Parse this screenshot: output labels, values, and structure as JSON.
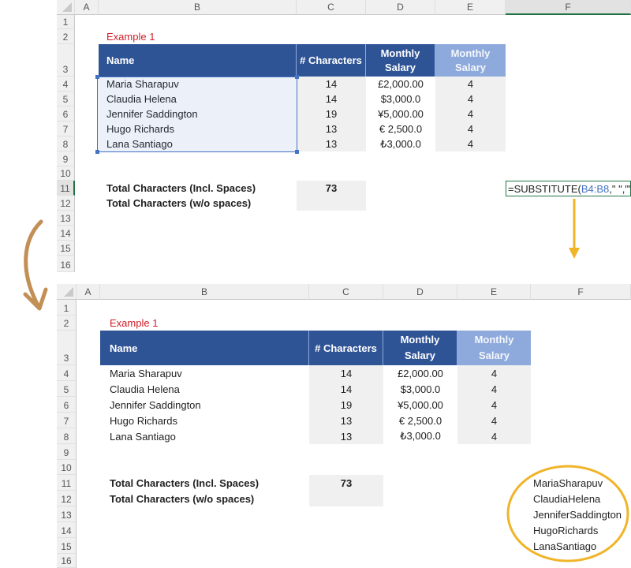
{
  "columns": [
    "A",
    "B",
    "C",
    "D",
    "E",
    "F"
  ],
  "rows": [
    "1",
    "2",
    "3",
    "4",
    "5",
    "6",
    "7",
    "8",
    "9",
    "10",
    "11",
    "12",
    "13",
    "14",
    "15",
    "16"
  ],
  "example_title": "Example 1",
  "table": {
    "headers": {
      "name": "Name",
      "characters": "# Characters",
      "salary_line1": "Monthly",
      "salary_line2": "Salary",
      "salary2_line1": "Monthly",
      "salary2_line2": "Salary"
    },
    "rows": [
      {
        "name": "Maria Sharapuv",
        "characters": "14",
        "salary": "£2,000.00",
        "salary_len": "4"
      },
      {
        "name": "Claudia Helena",
        "characters": "14",
        "salary": "$3,000.0",
        "salary_len": "4"
      },
      {
        "name": "Jennifer Saddington",
        "characters": "19",
        "salary": "¥5,000.00",
        "salary_len": "4"
      },
      {
        "name": "Hugo Richards",
        "characters": "13",
        "salary": "€ 2,500.0",
        "salary_len": "4"
      },
      {
        "name": "Lana Santiago",
        "characters": "13",
        "salary": "₺3,000.0",
        "salary_len": "4"
      }
    ]
  },
  "totals": {
    "incl_spaces_label": "Total Characters (Incl. Spaces)",
    "incl_spaces_value": "73",
    "wo_spaces_label": "Total Characters (w/o spaces)",
    "wo_spaces_value": ""
  },
  "formula": {
    "prefix": "=SUBSTITUTE(",
    "ref": "B4:B8",
    "suffix": ",\" \",\"\")"
  },
  "spill_results": [
    "MariaSharapuv",
    "ClaudiaHelena",
    "JenniferSaddington",
    "HugoRichards",
    "LanaSantiago"
  ],
  "colors": {
    "header_dark": "#2f5496",
    "header_light": "#8ea9db",
    "title_red": "#d0202a",
    "arrow_gold": "#f0b429",
    "arrow_brown": "#c28f55",
    "selection_blue": "#4472c4",
    "formula_green": "#217346"
  }
}
